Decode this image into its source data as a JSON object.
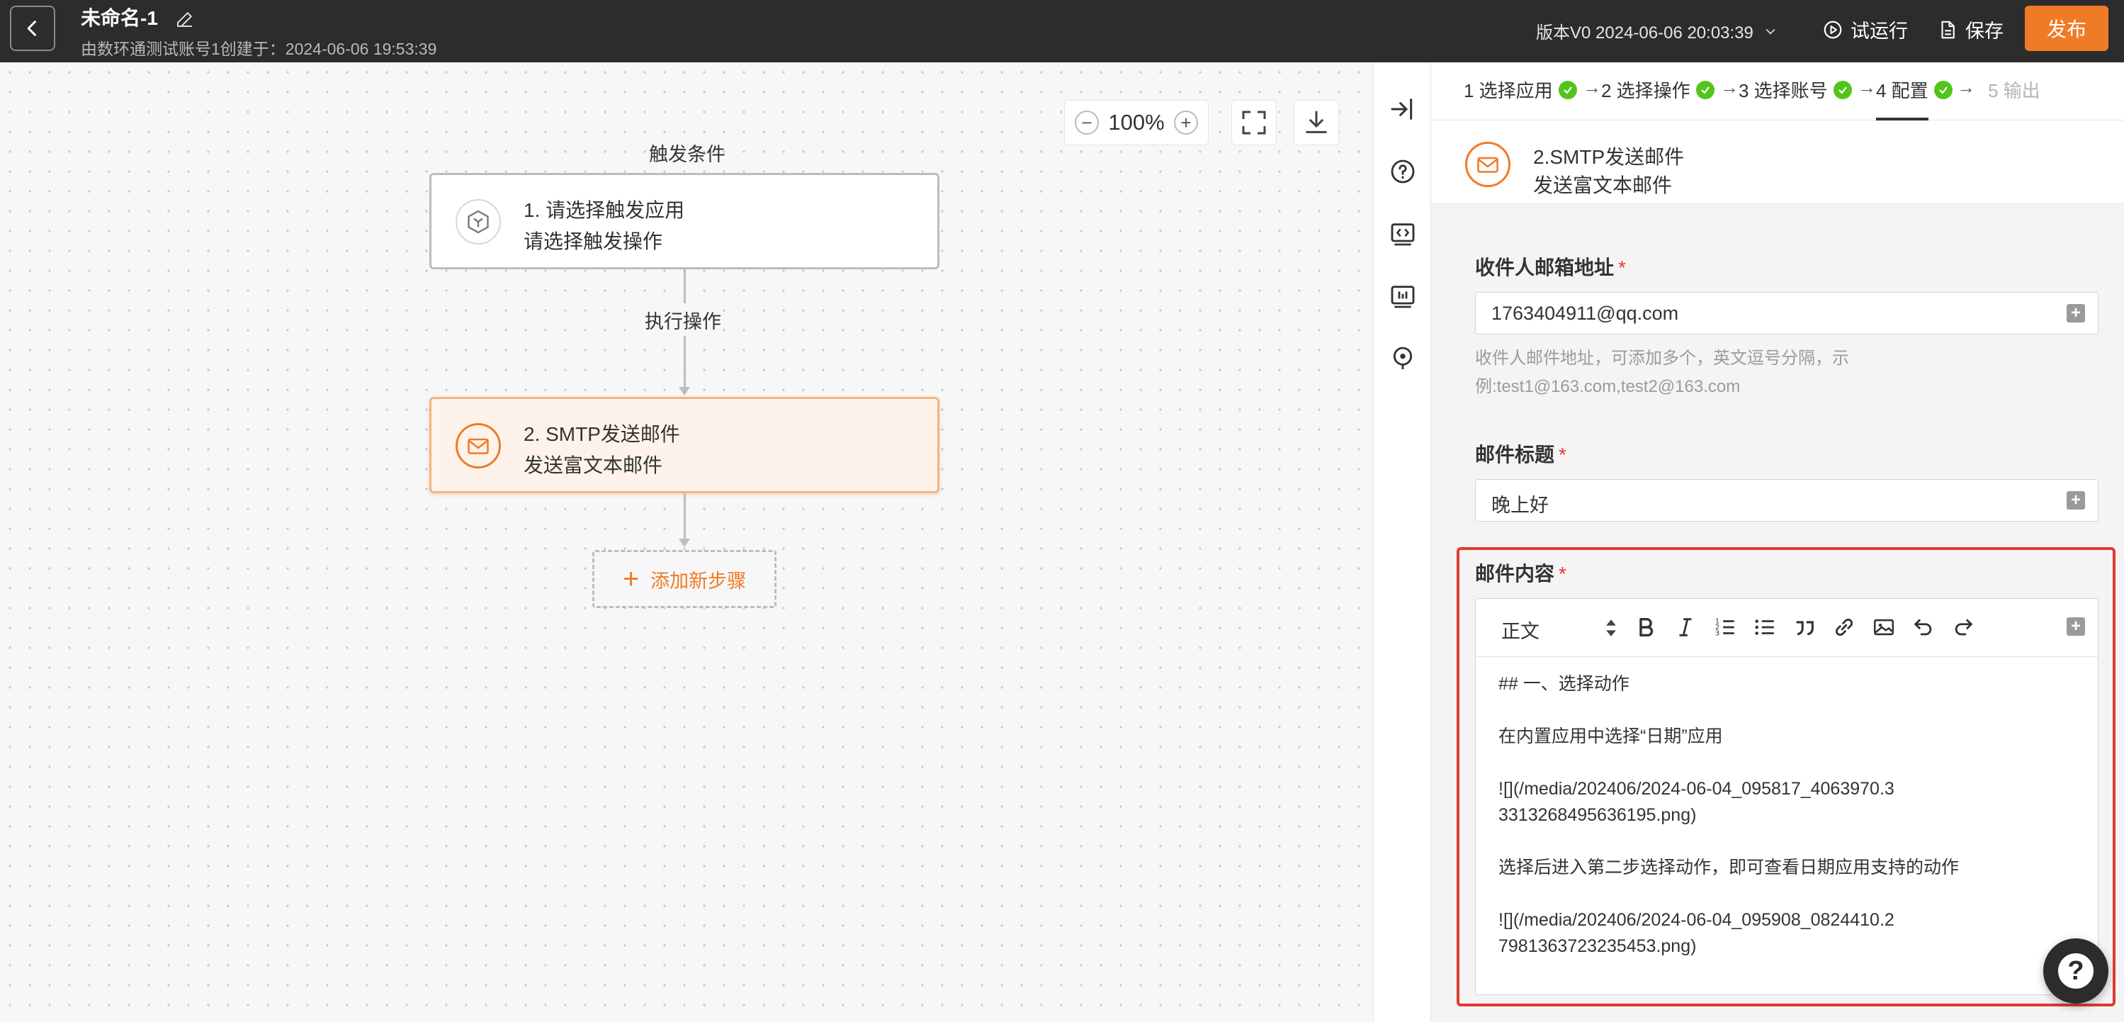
{
  "header": {
    "title": "未命名-1",
    "subtitle": "由数环通测试账号1创建于：2024-06-06 19:53:39",
    "version": "版本V0 2024-06-06 20:03:39",
    "trial_run": "试运行",
    "save": "保存",
    "publish": "发布",
    "accent": "#f07b27"
  },
  "canvas": {
    "zoom": "100%",
    "trigger_label": "触发条件",
    "trigger_node": {
      "line1": "1. 请选择触发应用",
      "line2": "请选择触发操作"
    },
    "exec_label": "执行操作",
    "action_node": {
      "line1": "2. SMTP发送邮件",
      "line2": "发送富文本邮件"
    },
    "add_step": "添加新步骤"
  },
  "steps": [
    {
      "label": "1 选择应用",
      "done": true
    },
    {
      "label": "2 选择操作",
      "done": true
    },
    {
      "label": "3 选择账号",
      "done": true
    },
    {
      "label": "4 配置",
      "done": true,
      "active": true
    },
    {
      "label": "5 输出",
      "done": false
    }
  ],
  "action": {
    "title": "2.SMTP发送邮件",
    "subtitle": "发送富文本邮件"
  },
  "form": {
    "recipient": {
      "label": "收件人邮箱地址",
      "required": "*",
      "value": "1763404911@qq.com",
      "hint_line1": "收件人邮件地址，可添加多个，英文逗号分隔，示",
      "hint_line2": "例:test1@163.com,test2@163.com"
    },
    "subject": {
      "label": "邮件标题",
      "required": "*",
      "value": "晚上好"
    },
    "content": {
      "label": "邮件内容",
      "required": "*",
      "format": "正文",
      "paragraphs": [
        "## 一、选择动作",
        "在内置应用中选择“日期”应用",
        "![](/media/202406/2024-06-04_095817_4063970.33313268495636195.png)",
        "选择后进入第二步选择动作，即可查看日期应用支持的动作",
        "![](/media/202406/2024-06-04_095908_0824410.27981363723235453.png)"
      ]
    }
  },
  "icons": [
    "chevron-left-icon",
    "edit-icon",
    "play-icon",
    "document-icon",
    "minus-icon",
    "plus-icon",
    "fullscreen-icon",
    "download-icon",
    "collapse-panel-icon",
    "help-icon",
    "code-icon",
    "chart-icon",
    "location-icon",
    "mail-icon",
    "cube-icon",
    "check-icon"
  ]
}
